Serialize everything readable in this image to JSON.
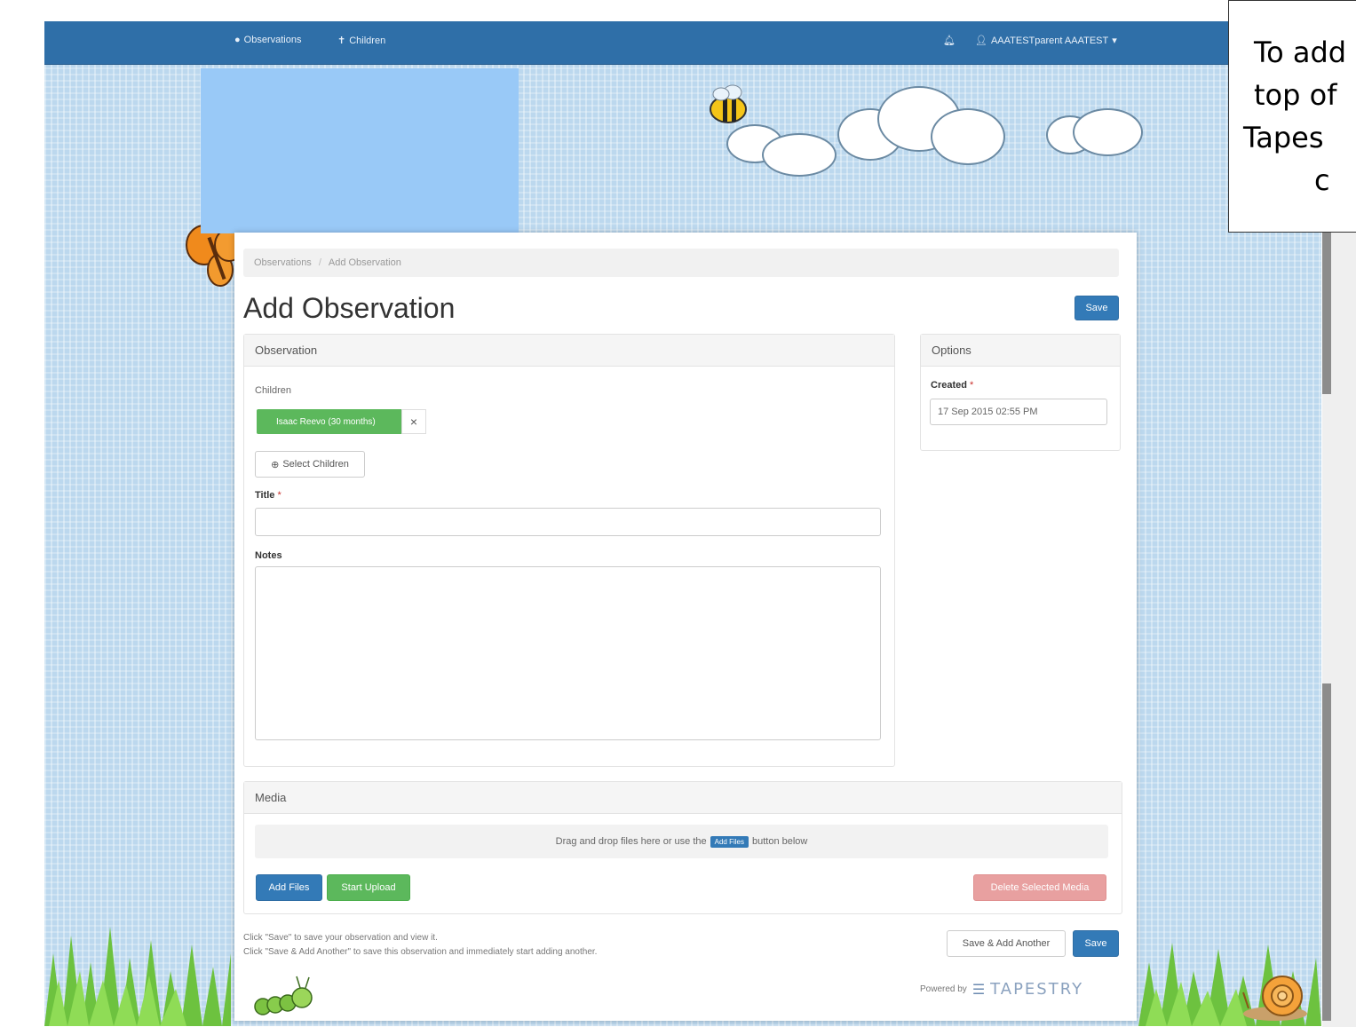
{
  "topnav": {
    "observations": "Observations",
    "children": "Children",
    "user": "AAATESTparent AAATEST"
  },
  "callout": {
    "line1": "To add",
    "line2": "top of",
    "line3": "Tapes",
    "line4": "c"
  },
  "breadcrumb": {
    "item1": "Observations",
    "separator": "/",
    "item2": "Add Observation"
  },
  "page": {
    "title": "Add Observation",
    "save_top": "Save"
  },
  "observation_panel": {
    "heading": "Observation",
    "children_label": "Children",
    "child_chip": "Isaac Reevo (30 months)",
    "chip_remove": "×",
    "select_children": "Select Children",
    "title_label": "Title",
    "notes_label": "Notes",
    "title_value": "",
    "notes_value": ""
  },
  "options_panel": {
    "heading": "Options",
    "created_label": "Created",
    "created_value": "17 Sep 2015 02:55 PM"
  },
  "required_mark": "*",
  "media_panel": {
    "heading": "Media",
    "dropzone_before": "Drag and drop files here or use the",
    "dropzone_button": "Add Files",
    "dropzone_after": "button below",
    "add_files": "Add Files",
    "start_upload": "Start Upload",
    "delete_selected": "Delete Selected Media"
  },
  "footer": {
    "help1": "Click \"Save\" to save your observation and view it.",
    "help2": "Click \"Save & Add Another\" to save this observation and immediately start adding another.",
    "save_add_another": "Save & Add Another",
    "save_bottom": "Save",
    "powered_by": "Powered by",
    "brand": "TAPESTRY"
  },
  "colors": {
    "nav": "#2f6fa8",
    "primary": "#337ab7",
    "success": "#5cb85c",
    "danger": "#e8a0a0",
    "logo_block": "#99c9f7"
  },
  "icons": [
    "eye-icon",
    "child-icon",
    "bell-icon",
    "user-icon",
    "caret-down-icon",
    "plus-circle-icon",
    "bee-icon",
    "butterfly-icon",
    "caterpillar-icon",
    "snail-icon",
    "cloud-icon",
    "grass-icon"
  ]
}
